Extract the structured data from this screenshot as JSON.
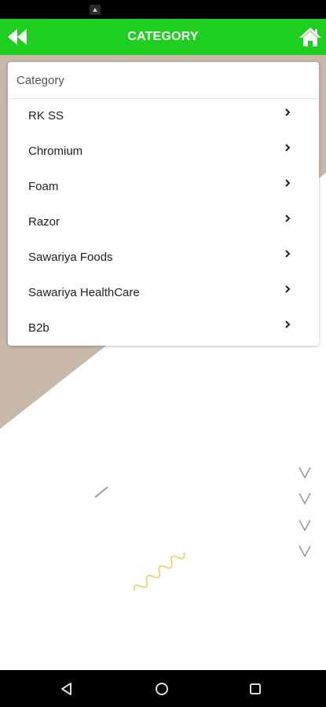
{
  "status_bar": {
    "icon": "notification-icon"
  },
  "app_bar": {
    "title": "CATEGORY",
    "back_icon": "double-chevron-left-icon",
    "home_icon": "home-icon",
    "background_color": "#1fcf1f"
  },
  "card": {
    "header": "Category",
    "items": [
      {
        "label": "RK SS"
      },
      {
        "label": "Chromium"
      },
      {
        "label": "Foam"
      },
      {
        "label": "Razor"
      },
      {
        "label": "Sawariya Foods"
      },
      {
        "label": "Sawariya HealthCare"
      },
      {
        "label": "B2b"
      }
    ],
    "item_icon": "chevron-right-icon"
  },
  "nav_bar": {
    "buttons": [
      "back-icon",
      "home-circle-icon",
      "recents-icon"
    ]
  }
}
